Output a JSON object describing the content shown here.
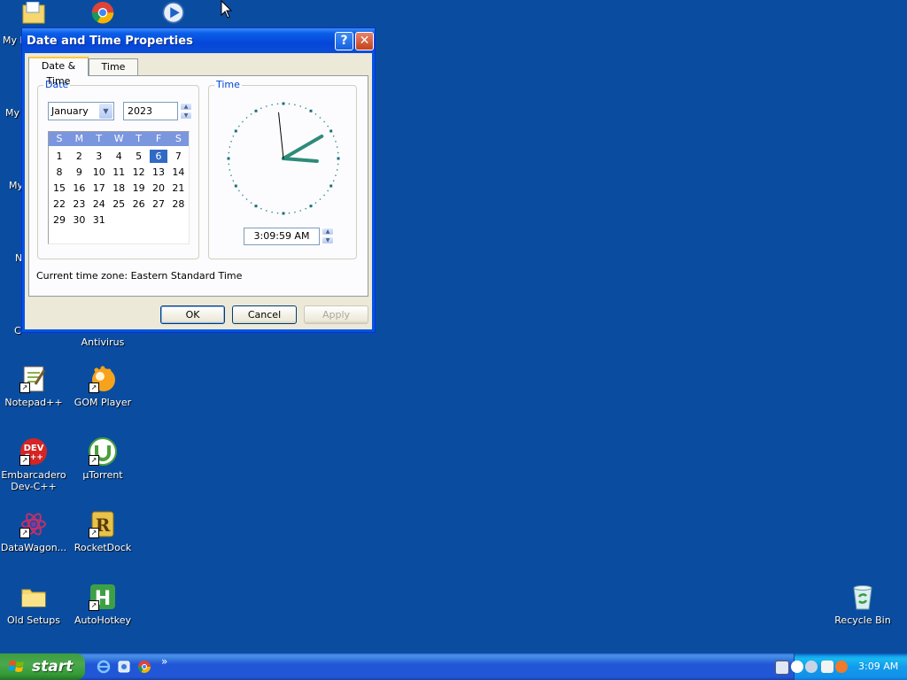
{
  "desktop": {
    "partial_labels": [
      "My I",
      "My",
      "My",
      "N",
      "C"
    ],
    "icons": [
      {
        "name": "antivirus",
        "label": "Antivirus"
      },
      {
        "name": "notepad-plus-plus",
        "label": "Notepad++"
      },
      {
        "name": "gom-player",
        "label": "GOM Player"
      },
      {
        "name": "embarcadero-dev-cpp",
        "label": "Embarcadero Dev-C++"
      },
      {
        "name": "utorrent",
        "label": "µTorrent"
      },
      {
        "name": "datawagon",
        "label": "DataWagon..."
      },
      {
        "name": "rocketdock",
        "label": "RocketDock"
      },
      {
        "name": "old-setups",
        "label": "Old Setups"
      },
      {
        "name": "autohotkey",
        "label": "AutoHotkey"
      },
      {
        "name": "recycle-bin",
        "label": "Recycle Bin"
      }
    ]
  },
  "dialog": {
    "title": "Date and Time Properties",
    "help_label": "?",
    "close_label": "✕",
    "tabs": [
      {
        "label": "Date & Time",
        "active": true
      },
      {
        "label": "Time Zone",
        "active": false
      }
    ],
    "date_group": {
      "title": "Date",
      "month": "January",
      "year": "2023",
      "day_names": [
        "S",
        "M",
        "T",
        "W",
        "T",
        "F",
        "S"
      ],
      "weeks": [
        [
          "1",
          "2",
          "3",
          "4",
          "5",
          "6",
          "7"
        ],
        [
          "8",
          "9",
          "10",
          "11",
          "12",
          "13",
          "14"
        ],
        [
          "15",
          "16",
          "17",
          "18",
          "19",
          "20",
          "21"
        ],
        [
          "22",
          "23",
          "24",
          "25",
          "26",
          "27",
          "28"
        ],
        [
          "29",
          "30",
          "31"
        ]
      ],
      "selected_day": "6"
    },
    "time_group": {
      "title": "Time",
      "time_value": "3:09:59 AM",
      "clock": {
        "hour": 3,
        "minute": 9,
        "second": 59
      }
    },
    "timezone_label": "Current time zone:  Eastern Standard Time",
    "buttons": {
      "ok": "OK",
      "cancel": "Cancel",
      "apply": "Apply"
    }
  },
  "taskbar": {
    "start_label": "start",
    "chevron": "»",
    "clock": "3:09 AM"
  },
  "colors": {
    "desktop": "#0a4da0",
    "titlebar": "#0546d8",
    "dialog_bg": "#ece9d8",
    "accent": "#0046d5",
    "selected": "#316ac5",
    "clock_hand": "#2e8b7a"
  }
}
